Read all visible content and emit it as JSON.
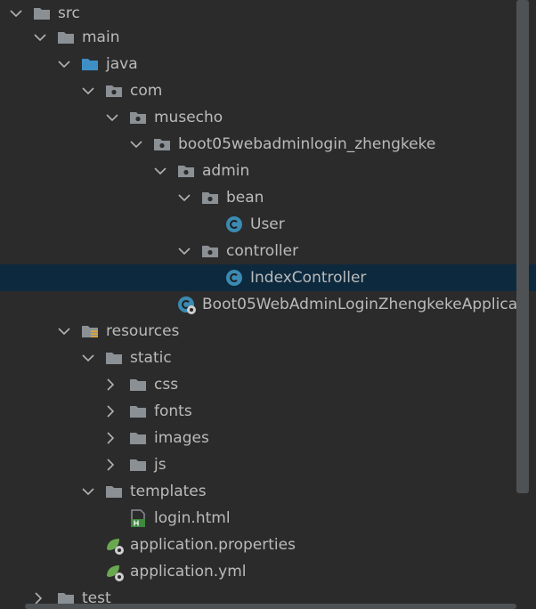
{
  "tree": {
    "items": [
      {
        "name": "tree-item-src",
        "label": "src",
        "icon": "folder-icon",
        "expanded": true
      },
      {
        "name": "tree-item-main",
        "label": "main",
        "icon": "folder-icon",
        "expanded": true
      },
      {
        "name": "tree-item-java",
        "label": "java",
        "icon": "source-folder-icon",
        "expanded": true
      },
      {
        "name": "tree-item-com",
        "label": "com",
        "icon": "package-icon",
        "expanded": true
      },
      {
        "name": "tree-item-musecho",
        "label": "musecho",
        "icon": "package-icon",
        "expanded": true
      },
      {
        "name": "tree-item-boot05",
        "label": "boot05webadminlogin_zhengkeke",
        "icon": "package-icon",
        "expanded": true
      },
      {
        "name": "tree-item-admin",
        "label": "admin",
        "icon": "package-icon",
        "expanded": true
      },
      {
        "name": "tree-item-bean",
        "label": "bean",
        "icon": "package-icon",
        "expanded": true
      },
      {
        "name": "tree-item-user",
        "label": "User",
        "icon": "class-icon"
      },
      {
        "name": "tree-item-controller",
        "label": "controller",
        "icon": "package-icon",
        "expanded": true
      },
      {
        "name": "tree-item-indexcontroller",
        "label": "IndexController",
        "icon": "class-icon",
        "selected": true
      },
      {
        "name": "tree-item-application-class",
        "label": "Boot05WebAdminLoginZhengkekeApplica",
        "icon": "spring-boot-class-icon"
      },
      {
        "name": "tree-item-resources",
        "label": "resources",
        "icon": "resources-folder-icon",
        "expanded": true
      },
      {
        "name": "tree-item-static",
        "label": "static",
        "icon": "folder-icon",
        "expanded": true
      },
      {
        "name": "tree-item-css",
        "label": "css",
        "icon": "folder-icon",
        "expanded": false
      },
      {
        "name": "tree-item-fonts",
        "label": "fonts",
        "icon": "folder-icon",
        "expanded": false
      },
      {
        "name": "tree-item-images",
        "label": "images",
        "icon": "folder-icon",
        "expanded": false
      },
      {
        "name": "tree-item-js",
        "label": "js",
        "icon": "folder-icon",
        "expanded": false
      },
      {
        "name": "tree-item-templates",
        "label": "templates",
        "icon": "folder-icon",
        "expanded": true
      },
      {
        "name": "tree-item-login-html",
        "label": "login.html",
        "icon": "html-file-icon"
      },
      {
        "name": "tree-item-app-properties",
        "label": "application.properties",
        "icon": "spring-config-icon"
      },
      {
        "name": "tree-item-app-yml",
        "label": "application.yml",
        "icon": "spring-config-icon"
      },
      {
        "name": "tree-item-test",
        "label": "test",
        "icon": "folder-icon",
        "expanded": false
      }
    ]
  },
  "colors": {
    "background": "#2b2b2b",
    "selection": "#0d293e",
    "text": "#bbbbbb",
    "folder": "#8b9095",
    "source_folder": "#3d8fc6",
    "class_badge": "#3b8ab2",
    "spring_green": "#6aa84f"
  }
}
